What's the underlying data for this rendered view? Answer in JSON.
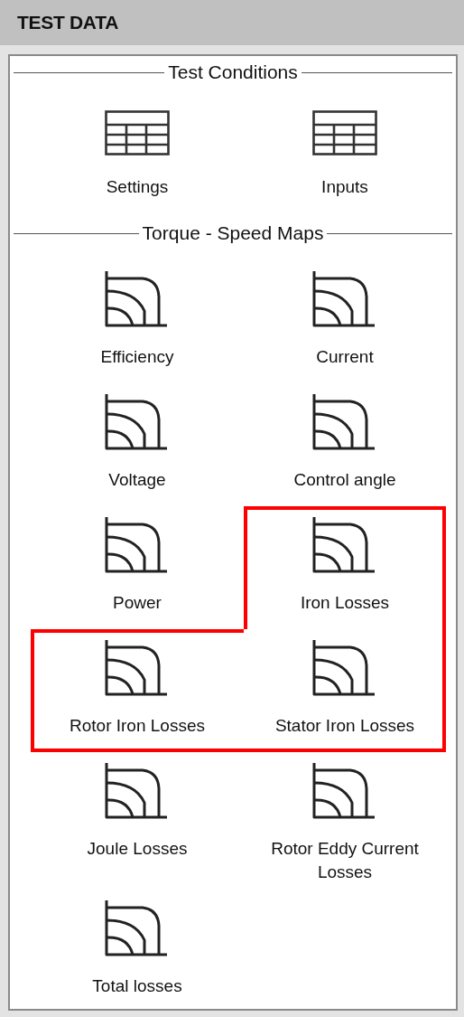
{
  "title": "TEST DATA",
  "sections": [
    {
      "title": "Test Conditions",
      "items": [
        {
          "label": "Settings",
          "kind": "table",
          "highlighted": false
        },
        {
          "label": "Inputs",
          "kind": "table",
          "highlighted": false
        }
      ]
    },
    {
      "title": "Torque - Speed Maps",
      "items": [
        {
          "label": "Efficiency",
          "kind": "map",
          "highlighted": false
        },
        {
          "label": "Current",
          "kind": "map",
          "highlighted": false
        },
        {
          "label": "Voltage",
          "kind": "map",
          "highlighted": false
        },
        {
          "label": "Control angle",
          "kind": "map",
          "highlighted": false
        },
        {
          "label": "Power",
          "kind": "map",
          "highlighted": false
        },
        {
          "label": "Iron Losses",
          "kind": "map",
          "highlighted": true
        },
        {
          "label": "Rotor Iron Losses",
          "kind": "map",
          "highlighted": true
        },
        {
          "label": "Stator Iron Losses",
          "kind": "map",
          "highlighted": true
        },
        {
          "label": "Joule Losses",
          "kind": "map",
          "highlighted": false
        },
        {
          "label": "Rotor Eddy Current Losses",
          "kind": "map",
          "highlighted": false
        },
        {
          "label": "Total losses",
          "kind": "map",
          "highlighted": false
        }
      ]
    }
  ]
}
